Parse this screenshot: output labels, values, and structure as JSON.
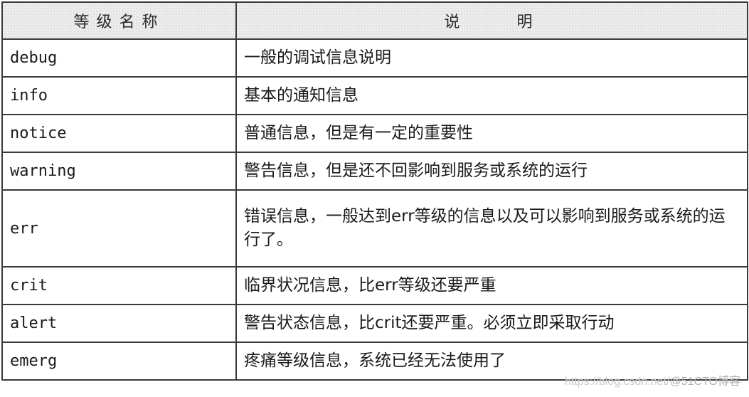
{
  "table": {
    "headers": {
      "level_name": "等级名称",
      "description_left": "说",
      "description_right": "明"
    },
    "rows": [
      {
        "level": "debug",
        "description": "一般的调试信息说明"
      },
      {
        "level": "info",
        "description": "基本的通知信息"
      },
      {
        "level": "notice",
        "description": "普通信息，但是有一定的重要性"
      },
      {
        "level": "warning",
        "description": "警告信息，但是还不回影响到服务或系统的运行"
      },
      {
        "level": "err",
        "description": "错误信息，一般达到err等级的信息以及可以影响到服务或系统的运行了。"
      },
      {
        "level": "crit",
        "description": "临界状况信息，比err等级还要严重"
      },
      {
        "level": "alert",
        "description": "警告状态信息，比crit还要严重。必须立即采取行动"
      },
      {
        "level": "emerg",
        "description": "疼痛等级信息，系统已经无法使用了"
      }
    ]
  },
  "watermark": {
    "url": "https://blog.csdn.net/",
    "brand": "@51CTO博客"
  }
}
